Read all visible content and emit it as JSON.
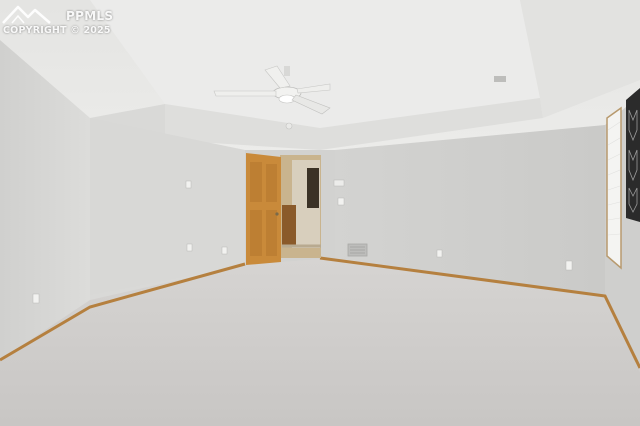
{
  "photo": {
    "subject": "Empty carpeted bedroom with ceiling fan, tray ceiling, open wooden door and window"
  },
  "watermark": {
    "brand": "PPMLS",
    "copyright": "COPYRIGHT © 2025",
    "logo_icon": "mountain-logo-icon"
  },
  "colors": {
    "wall": "#d4d4d2",
    "ceiling": "#e6e6e4",
    "carpet": "#cfcdcb",
    "baseboard": "#b5803f",
    "door": "#c98a3a"
  }
}
